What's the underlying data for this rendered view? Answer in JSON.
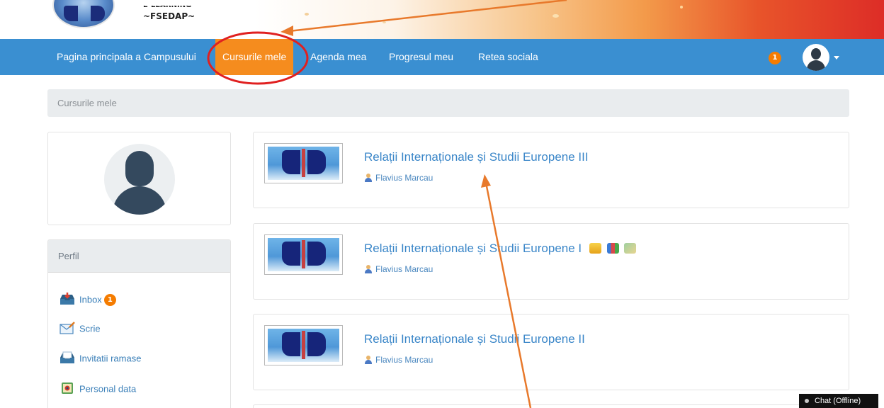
{
  "header": {
    "logo_line1": "E-LEARNING",
    "logo_line2": "~FSEDAP~"
  },
  "nav": {
    "items": [
      {
        "label": "Pagina principala a Campusului",
        "active": false
      },
      {
        "label": "Cursurile mele",
        "active": true
      },
      {
        "label": "Agenda mea",
        "active": false
      },
      {
        "label": "Progresul meu",
        "active": false
      },
      {
        "label": "Retea sociala",
        "active": false
      }
    ],
    "notification_count": "1",
    "user_icon": "user-avatar-icon"
  },
  "breadcrumb": {
    "text": "Cursurile mele"
  },
  "sidebar": {
    "profile_title": "Perfil",
    "links": [
      {
        "label": "Inbox",
        "icon": "inbox-icon",
        "badge": "1"
      },
      {
        "label": "Scrie",
        "icon": "compose-mail-icon"
      },
      {
        "label": "Invitatii ramase",
        "icon": "invitations-icon"
      },
      {
        "label": "Personal data",
        "icon": "personal-data-icon"
      }
    ]
  },
  "courses": [
    {
      "title": "Relații Internaționale și Studii Europene III",
      "teacher": "Flavius Marcau"
    },
    {
      "title": "Relații Internaționale și Studii Europene I",
      "teacher": "Flavius Marcau",
      "icons": [
        "folder-icon",
        "books-icon",
        "map-icon"
      ]
    },
    {
      "title": "Relații Internaționale și Studii Europene II",
      "teacher": "Flavius Marcau"
    }
  ],
  "chat": {
    "label": "Chat (Offline)"
  },
  "colors": {
    "nav_bg": "#3a8fd1",
    "nav_active": "#f58c1e",
    "badge": "#f57c00",
    "annotation_arrow": "#e8792b",
    "annotation_circle": "#e02020"
  }
}
